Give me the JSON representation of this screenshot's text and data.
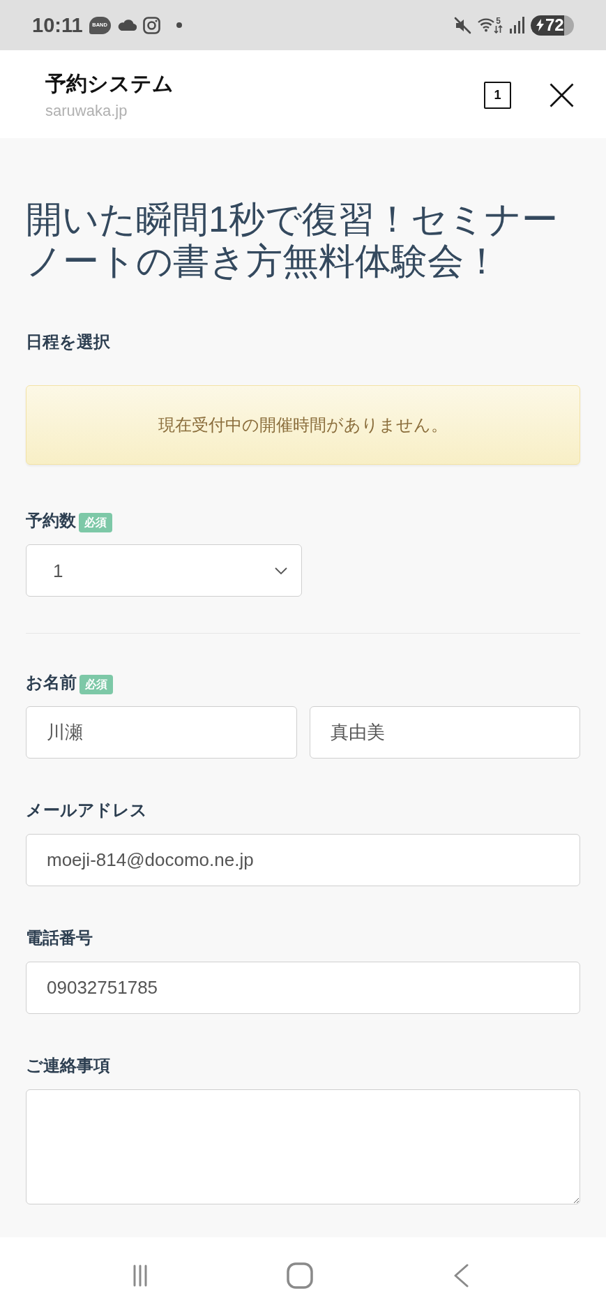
{
  "status_bar": {
    "time": "10:11",
    "app_logo": "BAND",
    "wifi_label": "5",
    "battery": "72"
  },
  "header": {
    "title": "予約システム",
    "domain": "saruwaka.jp",
    "tab_count": "1"
  },
  "page": {
    "title": "開いた瞬間1秒で復習！セミナーノートの書き方無料体験会！",
    "schedule_label": "日程を選択",
    "notice": "現在受付中の開催時間がありません。"
  },
  "form": {
    "fields": [
      {
        "kind": "select",
        "label": "予約数",
        "tag": "必須",
        "value": "1"
      },
      {
        "kind": "name",
        "label": "お名前",
        "tag": "必須",
        "values": [
          "川瀬",
          "真由美"
        ]
      },
      {
        "kind": "text",
        "label": "メールアドレス",
        "value": "moeji-814@docomo.ne.jp"
      },
      {
        "kind": "text",
        "label": "電話番号",
        "value": "09032751785"
      },
      {
        "kind": "textarea",
        "label": "ご連絡事項"
      }
    ]
  }
}
